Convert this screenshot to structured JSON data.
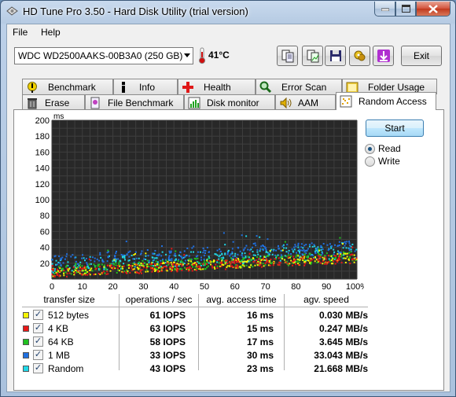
{
  "window": {
    "title": "HD Tune Pro 3.50 - Hard Disk Utility (trial version)",
    "min_icon": "minimize-icon",
    "max_icon": "maximize-icon",
    "close_icon": "close-icon"
  },
  "menu": {
    "file": "File",
    "help": "Help"
  },
  "toolbar": {
    "drive": "WDC WD2500AAKS-00B3A0 (250 GB)",
    "temperature": "41°C",
    "exit": "Exit"
  },
  "tabs_row1": [
    {
      "label": "Benchmark",
      "icon": "benchmark-icon"
    },
    {
      "label": "Info",
      "icon": "info-icon"
    },
    {
      "label": "Health",
      "icon": "health-icon"
    },
    {
      "label": "Error Scan",
      "icon": "error-scan-icon"
    },
    {
      "label": "Folder Usage",
      "icon": "folder-icon"
    }
  ],
  "tabs_row2": [
    {
      "label": "Erase",
      "icon": "erase-icon"
    },
    {
      "label": "File Benchmark",
      "icon": "file-benchmark-icon"
    },
    {
      "label": "Disk monitor",
      "icon": "disk-monitor-icon"
    },
    {
      "label": "AAM",
      "icon": "speaker-icon"
    },
    {
      "label": "Random Access",
      "icon": "random-access-icon"
    }
  ],
  "controls": {
    "start": "Start",
    "read": "Read",
    "write": "Write",
    "mode": "Read"
  },
  "results": {
    "headers": [
      "transfer size",
      "operations / sec",
      "avg. access time",
      "agv. speed"
    ],
    "rows": [
      {
        "size": "512 bytes",
        "color": "#f5f500",
        "iops": "61 IOPS",
        "access": "16 ms",
        "speed": "0.030 MB/s",
        "checked": true
      },
      {
        "size": "4 KB",
        "color": "#e81818",
        "iops": "63 IOPS",
        "access": "15 ms",
        "speed": "0.247 MB/s",
        "checked": true
      },
      {
        "size": "64 KB",
        "color": "#20c020",
        "iops": "58 IOPS",
        "access": "17 ms",
        "speed": "3.645 MB/s",
        "checked": true
      },
      {
        "size": "1 MB",
        "color": "#2070e0",
        "iops": "33 IOPS",
        "access": "30 ms",
        "speed": "33.043 MB/s",
        "checked": true
      },
      {
        "size": "Random",
        "color": "#20d8e8",
        "iops": "43 IOPS",
        "access": "23 ms",
        "speed": "21.668 MB/s",
        "checked": true
      }
    ]
  },
  "chart_data": {
    "type": "scatter",
    "ylabel": "ms",
    "ylim": [
      0,
      200
    ],
    "xlim": [
      0,
      100
    ],
    "y_ticks": [
      "200",
      "180",
      "160",
      "140",
      "120",
      "100",
      "80",
      "60",
      "40",
      "20"
    ],
    "x_ticks": [
      "0",
      "10",
      "20",
      "30",
      "40",
      "50",
      "60",
      "70",
      "80",
      "90",
      "100%"
    ],
    "grid": true,
    "background": "#282828",
    "series": [
      {
        "name": "512 bytes",
        "color": "#f5f500",
        "trend": [
          [
            0,
            9
          ],
          [
            100,
            27
          ]
        ],
        "spread": 6
      },
      {
        "name": "4 KB",
        "color": "#e81818",
        "trend": [
          [
            0,
            8
          ],
          [
            100,
            26
          ]
        ],
        "spread": 6
      },
      {
        "name": "64 KB",
        "color": "#20c020",
        "trend": [
          [
            0,
            11
          ],
          [
            100,
            28
          ]
        ],
        "spread": 7
      },
      {
        "name": "1 MB",
        "color": "#2070e0",
        "trend": [
          [
            0,
            24
          ],
          [
            100,
            40
          ]
        ],
        "spread": 8
      },
      {
        "name": "Random",
        "color": "#20d8e8",
        "trend": [
          [
            0,
            17
          ],
          [
            100,
            35
          ]
        ],
        "spread": 9
      }
    ]
  }
}
